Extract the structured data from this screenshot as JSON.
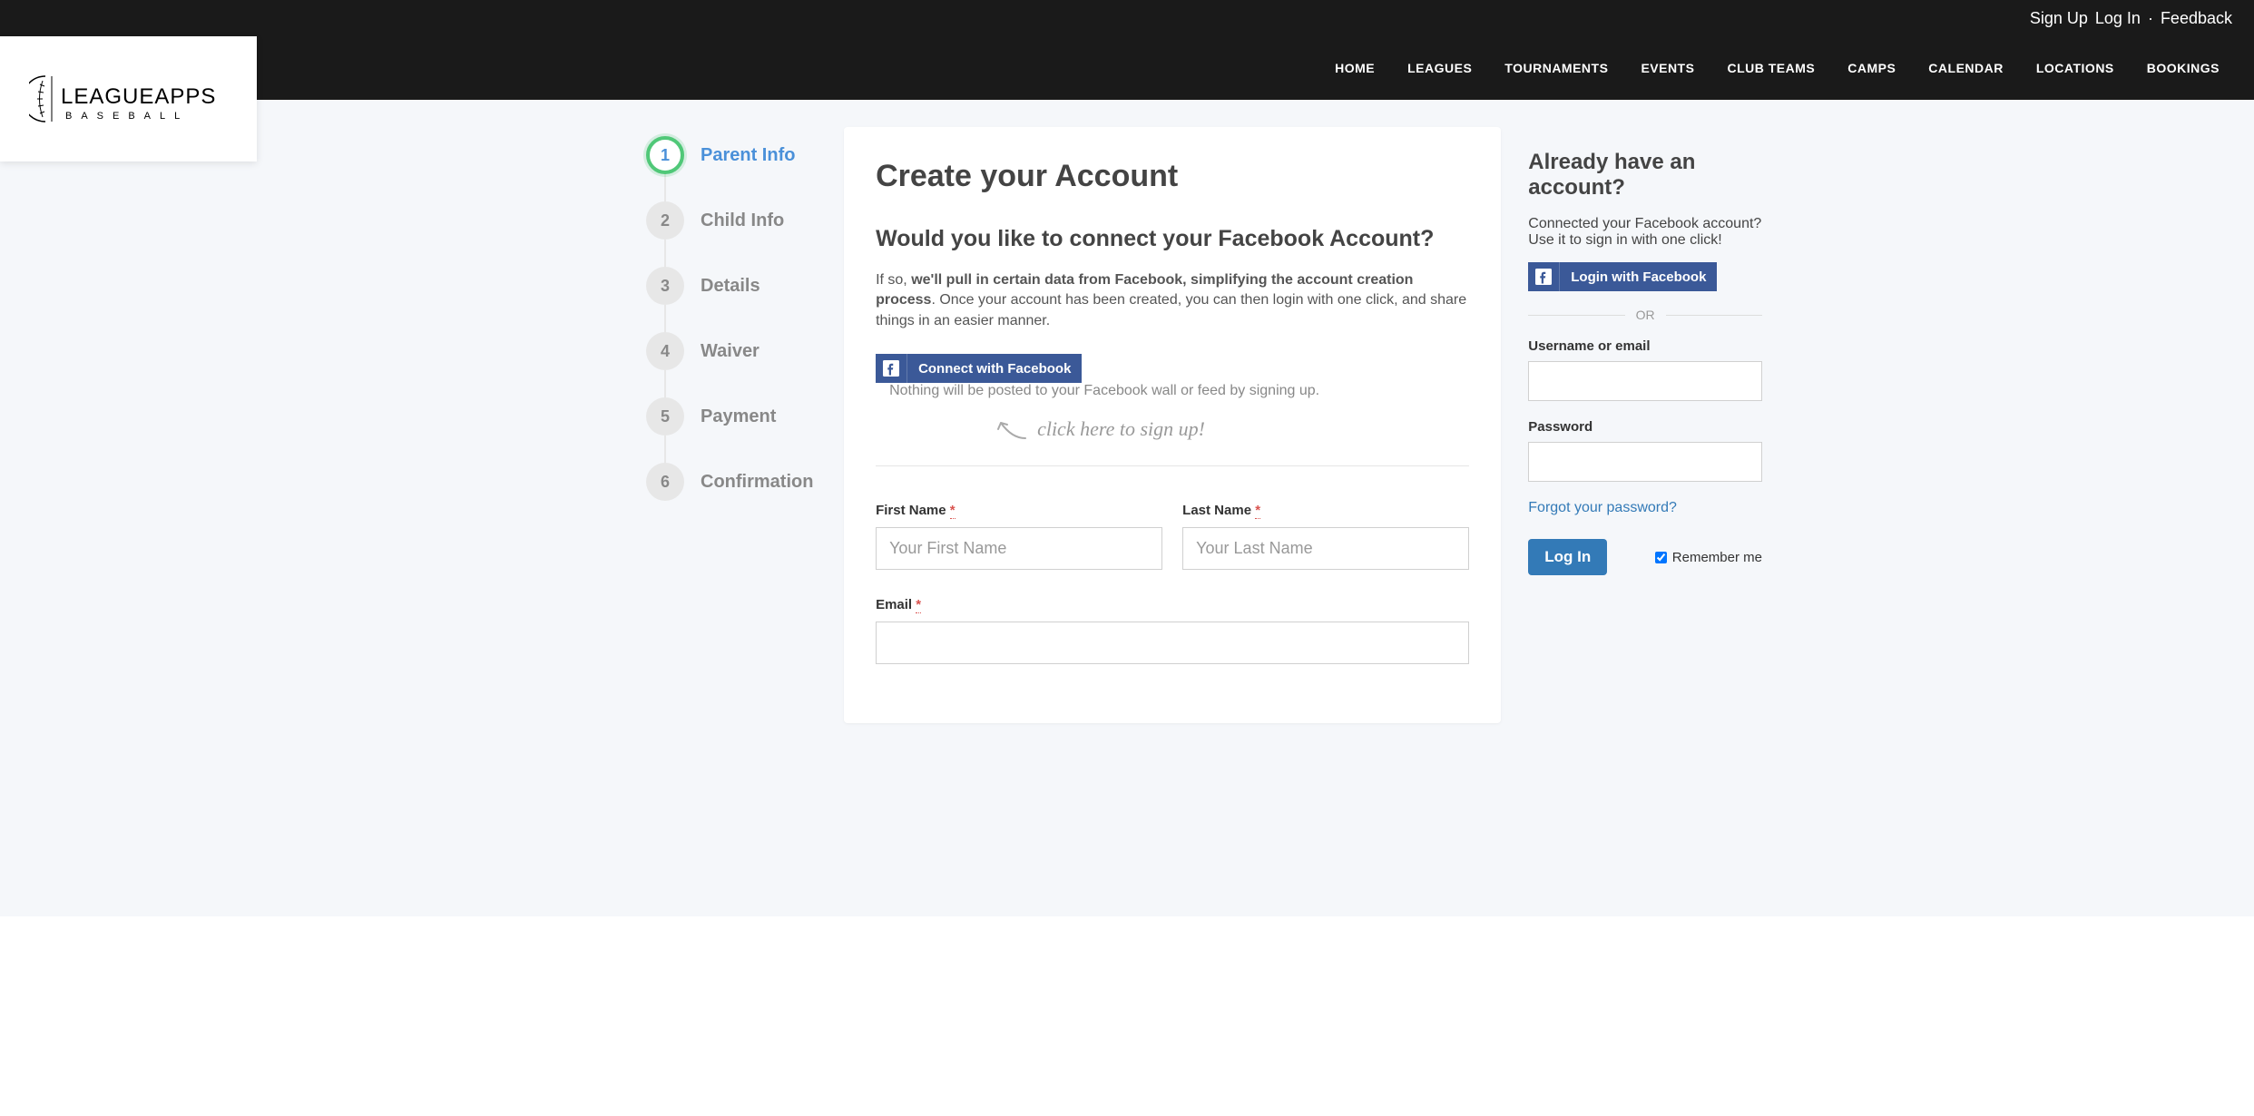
{
  "topbar": {
    "signup": "Sign Up",
    "login": "Log In",
    "feedback": "Feedback"
  },
  "nav": {
    "items": [
      "HOME",
      "LEAGUES",
      "TOURNAMENTS",
      "EVENTS",
      "CLUB TEAMS",
      "CAMPS",
      "CALENDAR",
      "LOCATIONS",
      "BOOKINGS"
    ]
  },
  "logo": {
    "main": "LEAGUEAPPS",
    "sub": "BASEBALL"
  },
  "steps": [
    {
      "num": "1",
      "label": "Parent Info",
      "active": true
    },
    {
      "num": "2",
      "label": "Child Info",
      "active": false
    },
    {
      "num": "3",
      "label": "Details",
      "active": false
    },
    {
      "num": "4",
      "label": "Waiver",
      "active": false
    },
    {
      "num": "5",
      "label": "Payment",
      "active": false
    },
    {
      "num": "6",
      "label": "Confirmation",
      "active": false
    }
  ],
  "main": {
    "title": "Create your Account",
    "fb_heading": "Would you like to connect your Facebook Account?",
    "fb_desc_prefix": "If so, ",
    "fb_desc_bold": "we'll pull in certain data from Facebook, simplifying the account creation process",
    "fb_desc_suffix": ". Once your account has been created, you can then login with one click, and share things in an easier manner.",
    "fb_button": "Connect with Facebook",
    "fb_note": "Nothing will be posted to your Facebook wall or feed by signing up.",
    "hint": "click here to sign up!",
    "form": {
      "first_name_label": "First Name",
      "first_name_placeholder": "Your First Name",
      "last_name_label": "Last Name",
      "last_name_placeholder": "Your Last Name",
      "email_label": "Email",
      "required_marker": "*"
    }
  },
  "sidebar": {
    "heading": "Already have an account?",
    "fb_text": "Connected your Facebook account? Use it to sign in with one click!",
    "fb_login_button": "Login with Facebook",
    "or": "OR",
    "username_label": "Username or email",
    "password_label": "Password",
    "forgot": "Forgot your password?",
    "login_button": "Log In",
    "remember": "Remember me"
  }
}
